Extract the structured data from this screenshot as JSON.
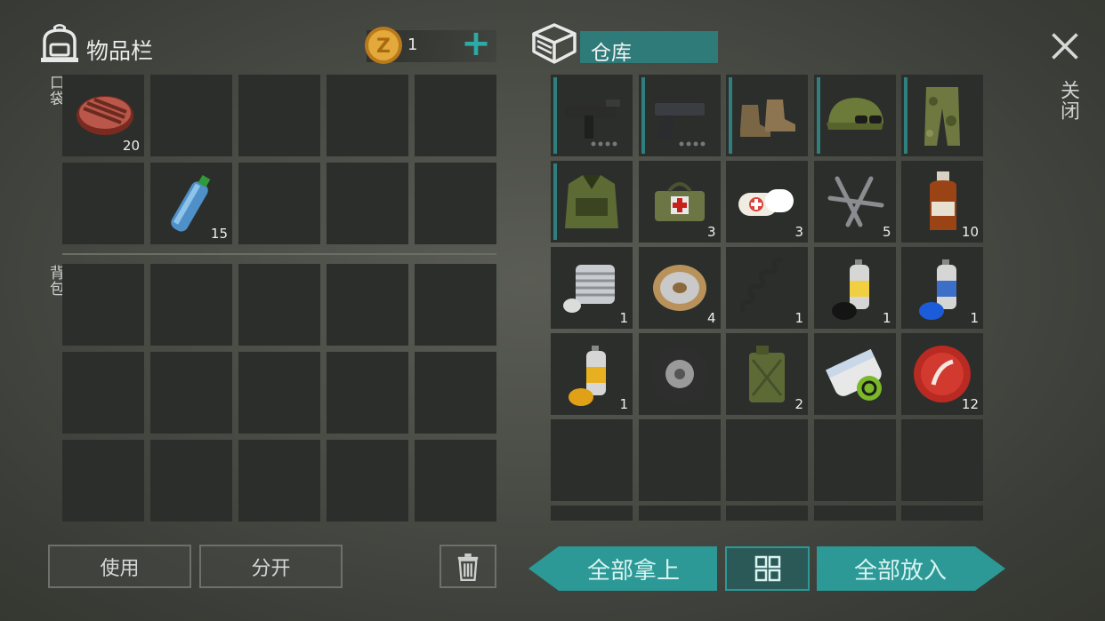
{
  "inventory": {
    "title": "物品栏",
    "coins": "1",
    "add_symbol": "+",
    "pocket_label": "口袋",
    "backpack_label": "背包",
    "pocket_slots": [
      {
        "item": "steak",
        "count": "20"
      },
      {
        "item": "",
        "count": ""
      },
      {
        "item": "",
        "count": ""
      },
      {
        "item": "",
        "count": ""
      },
      {
        "item": "",
        "count": ""
      },
      {
        "item": "",
        "count": ""
      },
      {
        "item": "water-bottle",
        "count": "15"
      },
      {
        "item": "",
        "count": ""
      },
      {
        "item": "",
        "count": ""
      },
      {
        "item": "",
        "count": ""
      }
    ]
  },
  "storage": {
    "title": "仓库",
    "slots": [
      {
        "item": "submachine-gun",
        "count": ""
      },
      {
        "item": "pistol",
        "count": ""
      },
      {
        "item": "boots",
        "count": ""
      },
      {
        "item": "camo-cap-sunglasses",
        "count": ""
      },
      {
        "item": "camo-pants",
        "count": ""
      },
      {
        "item": "tactical-vest",
        "count": ""
      },
      {
        "item": "first-aid-bag",
        "count": "3"
      },
      {
        "item": "bandage",
        "count": "3"
      },
      {
        "item": "nails",
        "count": "5"
      },
      {
        "item": "medicine-bottle",
        "count": "10"
      },
      {
        "item": "engine-cylinder",
        "count": "1"
      },
      {
        "item": "wire-spool",
        "count": "4"
      },
      {
        "item": "spring",
        "count": "1"
      },
      {
        "item": "spray-paint-black",
        "count": "1"
      },
      {
        "item": "spray-paint-blue",
        "count": "1"
      },
      {
        "item": "spray-paint-yellow",
        "count": "1"
      },
      {
        "item": "tire",
        "count": ""
      },
      {
        "item": "jerrycan",
        "count": "2"
      },
      {
        "item": "biohazard-poster",
        "count": ""
      },
      {
        "item": "bottle-cap",
        "count": "12"
      }
    ]
  },
  "actions": {
    "use": "使用",
    "split": "分开",
    "take_all": "全部拿上",
    "put_all": "全部放入"
  },
  "close_label": "关闭",
  "colors": {
    "accent": "#2c9996",
    "slot": "#2c2e2b",
    "background": "#494b45"
  }
}
